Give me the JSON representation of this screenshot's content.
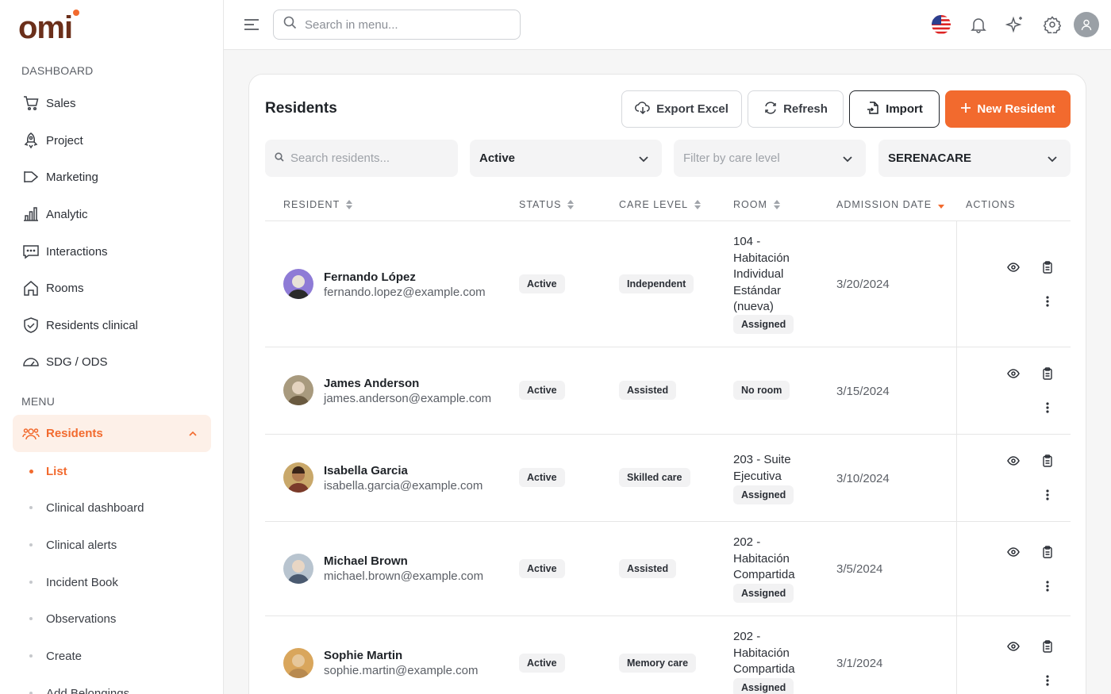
{
  "brand": {
    "logo_text": "omi",
    "logo_color": "#6b2f1a",
    "accent": "#f26a2e"
  },
  "sidebar": {
    "section_dashboard": "DASHBOARD",
    "dashboard_items": [
      {
        "label": "Sales",
        "icon": "cart-icon"
      },
      {
        "label": "Project",
        "icon": "rocket-icon"
      },
      {
        "label": "Marketing",
        "icon": "megaphone-icon"
      },
      {
        "label": "Analytic",
        "icon": "bar-chart-icon"
      },
      {
        "label": "Interactions",
        "icon": "chat-icon"
      },
      {
        "label": "Rooms",
        "icon": "home-icon"
      },
      {
        "label": "Residents clinical",
        "icon": "shield-check-icon"
      },
      {
        "label": "SDG / ODS",
        "icon": "gauge-icon"
      }
    ],
    "section_menu": "MENU",
    "residents": {
      "label": "Residents",
      "icon": "users-icon",
      "expanded": true
    },
    "residents_sub": [
      {
        "label": "List",
        "active": true
      },
      {
        "label": "Clinical dashboard"
      },
      {
        "label": "Clinical alerts"
      },
      {
        "label": "Incident Book"
      },
      {
        "label": "Observations"
      },
      {
        "label": "Create"
      },
      {
        "label": "Add Belongings"
      }
    ]
  },
  "topbar": {
    "search_placeholder": "Search in menu...",
    "icons": [
      "us-flag-icon",
      "bell-icon",
      "sparkle-icon",
      "gear-icon",
      "user-avatar-icon"
    ]
  },
  "page": {
    "title": "Residents",
    "buttons": {
      "export": "Export Excel",
      "refresh": "Refresh",
      "import": "Import",
      "new": "New Resident"
    },
    "filters": {
      "search_placeholder": "Search residents...",
      "status": "Active",
      "care_level_placeholder": "Filter by care level",
      "facility": "SERENACARE"
    },
    "columns": {
      "resident": "RESIDENT",
      "status": "STATUS",
      "care_level": "CARE LEVEL",
      "room": "ROOM",
      "admission_date": "ADMISSION DATE",
      "actions": "ACTIONS"
    },
    "rows": [
      {
        "name": "Fernando López",
        "email": "fernando.lopez@example.com",
        "status": "Active",
        "care_level": "Independent",
        "room_lines": [
          "104 -",
          "Habitación",
          "Individual",
          "Estándar",
          "(nueva)"
        ],
        "room_badge": "Assigned",
        "date": "3/20/2024",
        "avatar_bg": "#8e7bd6"
      },
      {
        "name": "James Anderson",
        "email": "james.anderson@example.com",
        "status": "Active",
        "care_level": "Assisted",
        "room_lines": [],
        "room_badge": "No room",
        "date": "3/15/2024",
        "avatar_bg": "#a89a7e"
      },
      {
        "name": "Isabella Garcia",
        "email": "isabella.garcia@example.com",
        "status": "Active",
        "care_level": "Skilled care",
        "room_lines": [
          "203 - Suite",
          "Ejecutiva"
        ],
        "room_badge": "Assigned",
        "date": "3/10/2024",
        "avatar_bg": "#c9a86a"
      },
      {
        "name": "Michael Brown",
        "email": "michael.brown@example.com",
        "status": "Active",
        "care_level": "Assisted",
        "room_lines": [
          "202 -",
          "Habitación",
          "Compartida"
        ],
        "room_badge": "Assigned",
        "date": "3/5/2024",
        "avatar_bg": "#b8c4cf"
      },
      {
        "name": "Sophie Martin",
        "email": "sophie.martin@example.com",
        "status": "Active",
        "care_level": "Memory care",
        "room_lines": [
          "202 -",
          "Habitación",
          "Compartida"
        ],
        "room_badge": "Assigned",
        "date": "3/1/2024",
        "avatar_bg": "#d9a65c"
      }
    ]
  }
}
